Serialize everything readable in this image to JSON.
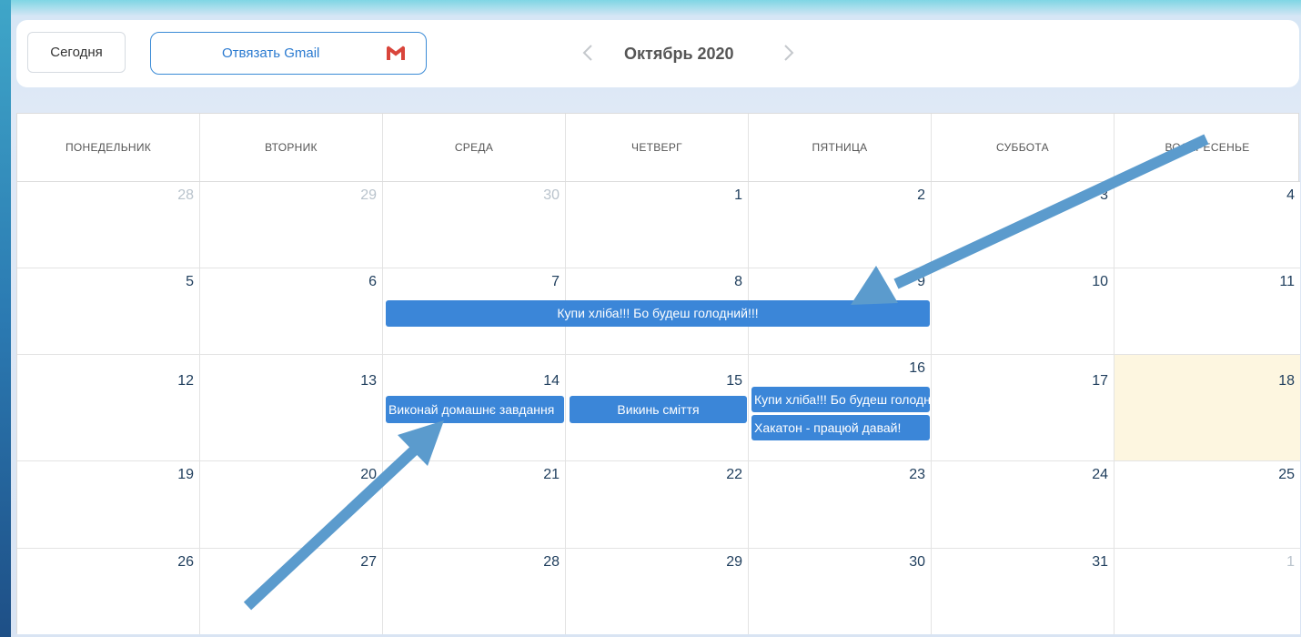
{
  "toolbar": {
    "today_label": "Сегодня",
    "gmail_label": "Отвязать Gmail",
    "month_title": "Октябрь 2020"
  },
  "icons": {
    "prev": "chevron-left-icon",
    "next": "chevron-right-icon",
    "gmail": "gmail-icon"
  },
  "weekdays": [
    "ПОНЕДЕЛЬНИК",
    "ВТОРНИК",
    "СРЕДА",
    "ЧЕТВЕРГ",
    "ПЯТНИЦА",
    "СУББОТА",
    "ВОСКРЕСЕНЬЕ"
  ],
  "weeks": [
    [
      "28",
      "29",
      "30",
      "1",
      "2",
      "3",
      "4"
    ],
    [
      "5",
      "6",
      "7",
      "8",
      "9",
      "10",
      "11"
    ],
    [
      "12",
      "13",
      "14",
      "15",
      "16",
      "17",
      "18"
    ],
    [
      "19",
      "20",
      "21",
      "22",
      "23",
      "24",
      "25"
    ],
    [
      "26",
      "27",
      "28",
      "29",
      "30",
      "31",
      "1"
    ]
  ],
  "events": {
    "bread_week": "Купи хліба!!! Бо будеш голодний!!!",
    "homework": "Виконай домашнє завдання",
    "trash": "Викинь сміття",
    "bread_16": "Купи хліба!!! Бо будеш голодний!!!",
    "hackathon": "Хакатон - працюй давай!"
  },
  "colors": {
    "event": "#3b86d8",
    "today_bg": "#fdf6e0",
    "arrow": "#5b9bcd",
    "accent": "#2a7ad0"
  }
}
